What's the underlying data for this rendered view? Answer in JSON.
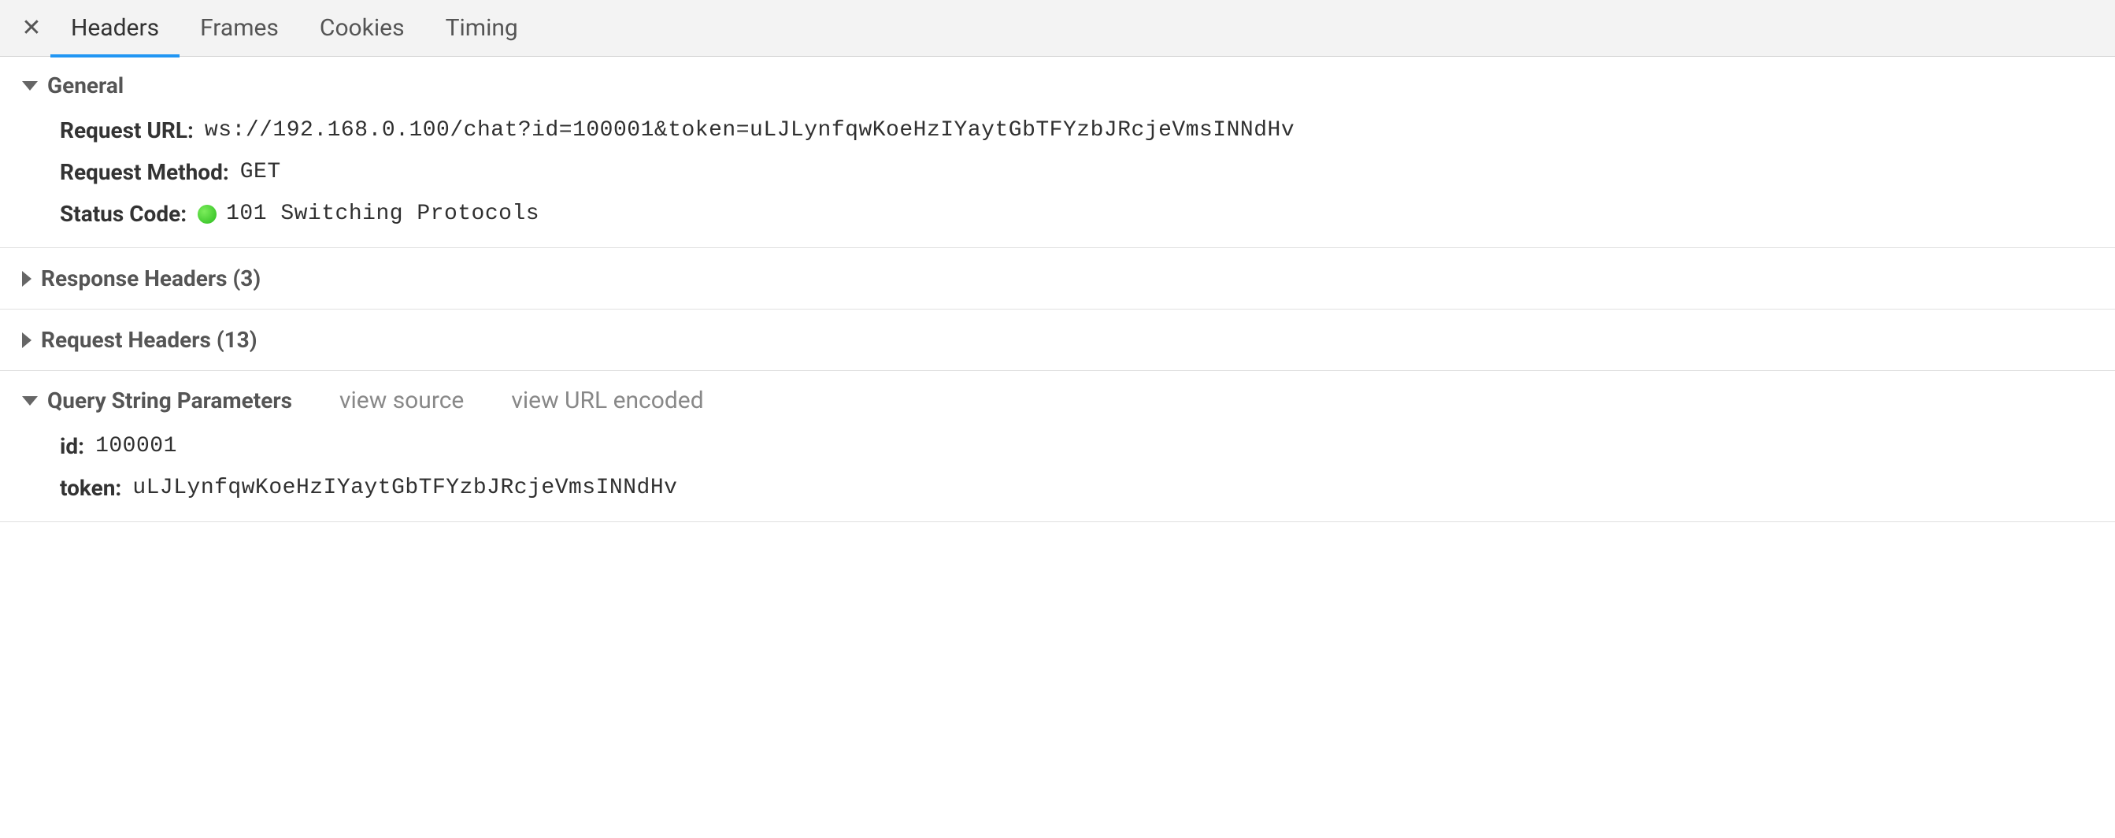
{
  "tabs": {
    "headers": "Headers",
    "frames": "Frames",
    "cookies": "Cookies",
    "timing": "Timing"
  },
  "sections": {
    "general": {
      "title": "General",
      "rows": {
        "request_url": {
          "label": "Request URL:",
          "value": "ws://192.168.0.100/chat?id=100001&token=uLJLynfqwKoeHzIYaytGbTFYzbJRcjeVmsINNdHv"
        },
        "request_method": {
          "label": "Request Method:",
          "value": "GET"
        },
        "status_code": {
          "label": "Status Code:",
          "value": "101 Switching Protocols"
        }
      }
    },
    "response_headers": {
      "title": "Response Headers (3)"
    },
    "request_headers": {
      "title": "Request Headers (13)"
    },
    "query_string": {
      "title": "Query String Parameters",
      "view_source": "view source",
      "view_url_encoded": "view URL encoded",
      "params": {
        "id": {
          "label": "id:",
          "value": "100001"
        },
        "token": {
          "label": "token:",
          "value": "uLJLynfqwKoeHzIYaytGbTFYzbJRcjeVmsINNdHv"
        }
      }
    }
  }
}
